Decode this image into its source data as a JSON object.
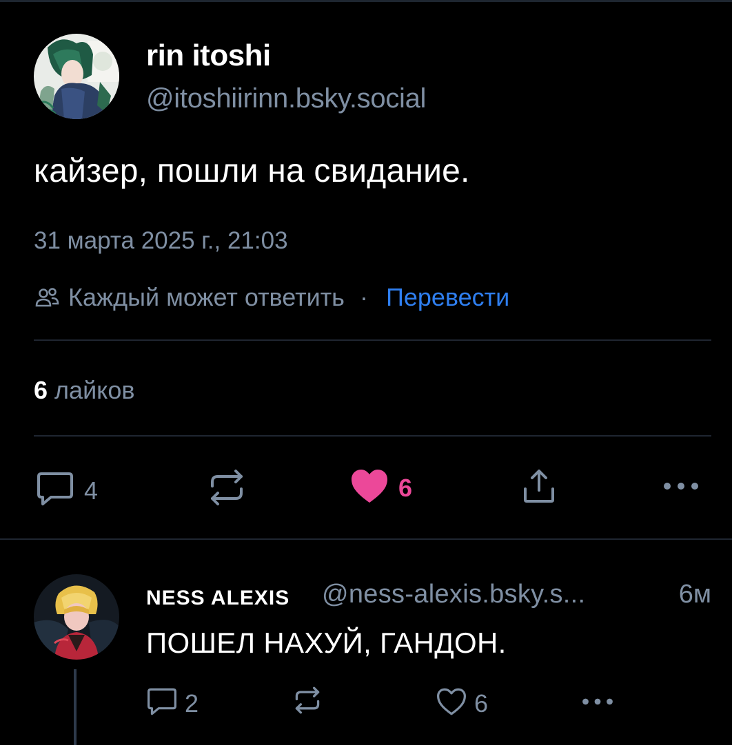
{
  "post": {
    "author": {
      "display_name": "rin itoshi",
      "handle": "@itoshiirinn.bsky.social"
    },
    "text": "кайзер, пошли на свидание.",
    "timestamp": "31 марта 2025 г., 21:03",
    "reply_setting": "Каждый может ответить",
    "separator": "·",
    "translate_label": "Перевести",
    "likes_count": "6",
    "likes_word": "лайков",
    "actions": {
      "reply_count": "4",
      "like_count": "6"
    }
  },
  "reply": {
    "author": {
      "display_name": "NESS ALEXIS",
      "handle": "@ness-alexis.bsky.s..."
    },
    "time_ago": "6м",
    "text": "ПОШЕЛ НАХУЙ, ГАНДОН.",
    "actions": {
      "reply_count": "2",
      "like_count": "6"
    }
  },
  "colors": {
    "background": "#000000",
    "muted_text": "#7f8fa3",
    "link": "#2f7ff0",
    "liked": "#ec4899",
    "divider": "#1f2631"
  },
  "icons": {
    "reply_setting": "people-icon",
    "reply": "comment-icon",
    "repost": "repost-icon",
    "like": "heart-icon",
    "share": "share-icon",
    "more": "more-icon"
  }
}
